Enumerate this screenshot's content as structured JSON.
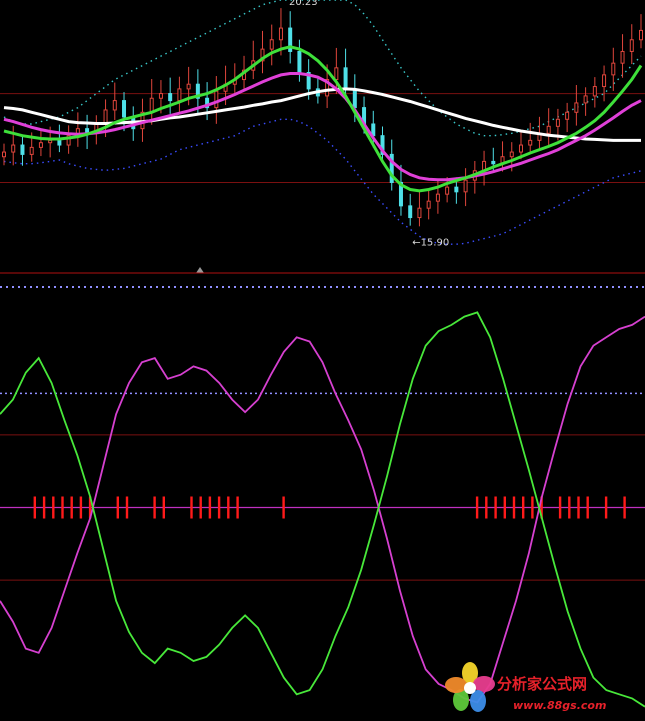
{
  "colors": {
    "background": "#000000",
    "candle_up": "#e0463c",
    "candle_down": "#4fe0e8",
    "ma_white": "#ffffff",
    "ma_magenta": "#e040d8",
    "ma_green": "#3ee03a",
    "band_blue": "#3a4cff",
    "band_cyan": "#39c7c9",
    "grid_red": "#7a1010",
    "osc_magenta": "#d640d0",
    "osc_green": "#48e83a",
    "signal_red": "#ff1a1a",
    "zero_line": "#c030c0",
    "divider_dots": "#8f8fff"
  },
  "chart_data": [
    {
      "type": "candlestick",
      "panel": "price",
      "annotations": [
        {
          "text": "20.23",
          "near": "top"
        },
        {
          "text": "←15.90",
          "near": "low"
        }
      ],
      "ylim": [
        15.0,
        20.6
      ],
      "series": [
        {
          "role": "close",
          "values": [
            17.35,
            17.5,
            17.3,
            17.45,
            17.55,
            17.6,
            17.5,
            17.7,
            17.85,
            17.75,
            17.95,
            18.25,
            18.45,
            18.1,
            17.85,
            18.2,
            18.5,
            18.6,
            18.45,
            18.7,
            18.8,
            18.5,
            18.3,
            18.65,
            18.8,
            18.9,
            19.1,
            19.3,
            19.55,
            19.75,
            20.0,
            19.5,
            19.05,
            18.7,
            18.55,
            18.9,
            19.15,
            18.7,
            18.3,
            17.95,
            17.7,
            17.3,
            16.7,
            16.2,
            15.95,
            16.15,
            16.3,
            16.45,
            16.6,
            16.5,
            16.75,
            16.95,
            17.15,
            17.1,
            17.25,
            17.35,
            17.5,
            17.6,
            17.75,
            17.9,
            18.05,
            18.2,
            18.4,
            18.55,
            18.75,
            19.0,
            19.25,
            19.5,
            19.75,
            19.95
          ]
        },
        {
          "role": "ma_white",
          "values": [
            18.3,
            18.28,
            18.25,
            18.2,
            18.15,
            18.1,
            18.05,
            18.0,
            17.98,
            17.97,
            17.96,
            17.96,
            17.97,
            17.98,
            17.99,
            18.0,
            18.02,
            18.05,
            18.08,
            18.1,
            18.13,
            18.16,
            18.19,
            18.22,
            18.25,
            18.28,
            18.31,
            18.35,
            18.38,
            18.42,
            18.45,
            18.5,
            18.55,
            18.6,
            18.64,
            18.67,
            18.69,
            18.7,
            18.69,
            18.66,
            18.62,
            18.58,
            18.53,
            18.48,
            18.43,
            18.37,
            18.31,
            18.25,
            18.19,
            18.13,
            18.07,
            18.02,
            17.97,
            17.92,
            17.88,
            17.84,
            17.8,
            17.77,
            17.74,
            17.71,
            17.69,
            17.67,
            17.65,
            17.63,
            17.62,
            17.61,
            17.6,
            17.6,
            17.6,
            17.6
          ]
        },
        {
          "role": "ma_magenta",
          "values": [
            18.05,
            18.0,
            17.94,
            17.88,
            17.83,
            17.79,
            17.76,
            17.74,
            17.73,
            17.74,
            17.76,
            17.79,
            17.83,
            17.88,
            17.93,
            17.98,
            18.03,
            18.08,
            18.13,
            18.18,
            18.23,
            18.29,
            18.35,
            18.42,
            18.5,
            18.58,
            18.67,
            18.76,
            18.85,
            18.93,
            19.0,
            19.03,
            19.03,
            19.0,
            18.95,
            18.85,
            18.7,
            18.5,
            18.25,
            17.95,
            17.65,
            17.38,
            17.15,
            16.98,
            16.87,
            16.8,
            16.77,
            16.76,
            16.76,
            16.78,
            16.8,
            16.84,
            16.88,
            16.93,
            16.99,
            17.05,
            17.11,
            17.18,
            17.25,
            17.32,
            17.4,
            17.5,
            17.6,
            17.7,
            17.82,
            17.95,
            18.08,
            18.22,
            18.35,
            18.45
          ]
        },
        {
          "role": "ma_green",
          "values": [
            17.8,
            17.75,
            17.7,
            17.67,
            17.64,
            17.63,
            17.63,
            17.65,
            17.68,
            17.73,
            17.8,
            17.88,
            17.98,
            18.05,
            18.1,
            18.15,
            18.2,
            18.28,
            18.35,
            18.42,
            18.5,
            18.55,
            18.6,
            18.68,
            18.78,
            18.9,
            19.05,
            19.2,
            19.35,
            19.47,
            19.55,
            19.6,
            19.55,
            19.45,
            19.3,
            19.1,
            18.85,
            18.55,
            18.2,
            17.85,
            17.5,
            17.15,
            16.85,
            16.65,
            16.55,
            16.52,
            16.55,
            16.6,
            16.68,
            16.74,
            16.8,
            16.87,
            16.95,
            17.03,
            17.1,
            17.17,
            17.25,
            17.33,
            17.4,
            17.47,
            17.55,
            17.65,
            17.75,
            17.88,
            18.02,
            18.2,
            18.42,
            18.65,
            18.9,
            19.2
          ]
        },
        {
          "role": "band_upper",
          "values": [
            18.1,
            18.0,
            17.95,
            17.95,
            18.0,
            18.05,
            18.1,
            18.2,
            18.3,
            18.45,
            18.6,
            18.75,
            18.9,
            19.0,
            19.1,
            19.2,
            19.3,
            19.4,
            19.5,
            19.6,
            19.7,
            19.8,
            19.9,
            20.0,
            20.1,
            20.2,
            20.3,
            20.4,
            20.5,
            20.55,
            20.6,
            20.6,
            20.6,
            20.6,
            20.6,
            20.6,
            20.6,
            20.6,
            20.5,
            20.3,
            20.05,
            19.75,
            19.45,
            19.15,
            18.9,
            18.65,
            18.45,
            18.25,
            18.1,
            17.95,
            17.85,
            17.75,
            17.7,
            17.7,
            17.72,
            17.75,
            17.8,
            17.85,
            17.9,
            18.0,
            18.1,
            18.2,
            18.3,
            18.4,
            18.5,
            18.6,
            18.8,
            19.0,
            19.2,
            19.4
          ]
        },
        {
          "role": "band_lower",
          "values": [
            17.15,
            17.12,
            17.1,
            17.1,
            17.12,
            17.15,
            17.18,
            17.1,
            17.05,
            17.0,
            16.98,
            16.96,
            16.98,
            17.0,
            17.05,
            17.1,
            17.15,
            17.2,
            17.3,
            17.4,
            17.45,
            17.5,
            17.55,
            17.6,
            17.65,
            17.7,
            17.8,
            17.9,
            17.95,
            18.0,
            18.05,
            18.05,
            18.0,
            17.9,
            17.75,
            17.6,
            17.4,
            17.2,
            16.95,
            16.7,
            16.45,
            16.25,
            16.05,
            15.85,
            15.7,
            15.55,
            15.45,
            15.4,
            15.38,
            15.38,
            15.4,
            15.45,
            15.5,
            15.55,
            15.6,
            15.7,
            15.8,
            15.9,
            16.0,
            16.1,
            16.2,
            16.3,
            16.4,
            16.5,
            16.6,
            16.7,
            16.8,
            16.85,
            16.9,
            16.95
          ]
        }
      ]
    },
    {
      "type": "line",
      "panel": "oscillator",
      "ylim": [
        -100,
        100
      ],
      "series": [
        {
          "role": "osc_green",
          "values": [
            45,
            52,
            65,
            72,
            60,
            42,
            25,
            5,
            -20,
            -45,
            -60,
            -70,
            -75,
            -68,
            -70,
            -74,
            -72,
            -66,
            -58,
            -52,
            -58,
            -70,
            -82,
            -90,
            -88,
            -78,
            -62,
            -48,
            -30,
            -8,
            15,
            40,
            62,
            78,
            85,
            88,
            92,
            94,
            82,
            62,
            40,
            18,
            -5,
            -28,
            -50,
            -68,
            -82,
            -88,
            -90,
            -92,
            -96
          ]
        },
        {
          "role": "osc_magenta",
          "values": [
            -45,
            -55,
            -68,
            -70,
            -58,
            -40,
            -22,
            -5,
            20,
            45,
            60,
            70,
            72,
            62,
            64,
            68,
            66,
            60,
            52,
            46,
            52,
            64,
            75,
            82,
            80,
            70,
            55,
            42,
            28,
            8,
            -15,
            -40,
            -62,
            -78,
            -85,
            -88,
            -92,
            -94,
            -85,
            -65,
            -45,
            -22,
            5,
            28,
            50,
            68,
            78,
            82,
            86,
            88,
            92
          ]
        }
      ],
      "signals": [
        3,
        4,
        5,
        6,
        7,
        8,
        9,
        12,
        13,
        16,
        17,
        20,
        21,
        22,
        23,
        24,
        25,
        30,
        51,
        52,
        53,
        54,
        55,
        56,
        57,
        58,
        60,
        61,
        62,
        63,
        65,
        67
      ]
    }
  ],
  "watermark": {
    "site_name": "分析家公式网",
    "url": "www.88gs.com",
    "logo_icon": "flower-pinwheel-logo"
  }
}
